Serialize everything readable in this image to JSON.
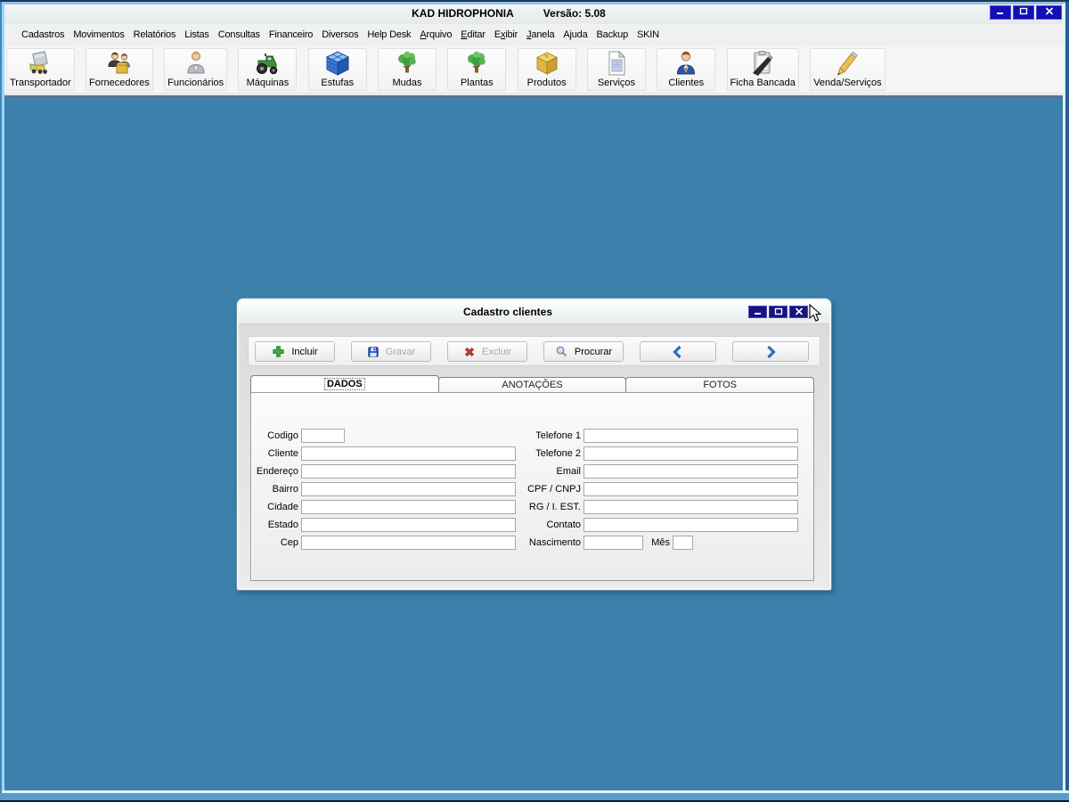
{
  "window": {
    "title": "KAD HIDROPHONIA",
    "version": "Versão: 5.08",
    "controls": [
      {
        "name": "minimize",
        "icon": "minimize-icon"
      },
      {
        "name": "maximize",
        "icon": "maximize-icon"
      },
      {
        "name": "close",
        "icon": "close-icon"
      }
    ]
  },
  "menu": {
    "items": [
      {
        "label": "Cadastros",
        "underline": -1
      },
      {
        "label": "Movimentos",
        "underline": -1
      },
      {
        "label": "Relatórios",
        "underline": -1
      },
      {
        "label": "Listas",
        "underline": -1
      },
      {
        "label": "Consultas",
        "underline": -1
      },
      {
        "label": "Financeiro",
        "underline": -1
      },
      {
        "label": "Diversos",
        "underline": -1
      },
      {
        "label": "Help Desk",
        "underline": -1
      },
      {
        "label": "Arquivo",
        "underline": 0
      },
      {
        "label": "Editar",
        "underline": 0
      },
      {
        "label": "Exibir",
        "underline": 1
      },
      {
        "label": "Janela",
        "underline": 0
      },
      {
        "label": "Ajuda",
        "underline": -1
      },
      {
        "label": "Backup",
        "underline": -1
      },
      {
        "label": "SKIN",
        "underline": -1
      }
    ]
  },
  "toolbar": {
    "buttons": [
      {
        "label": "Transportador",
        "icon": "truck-icon"
      },
      {
        "label": "Fornecedores",
        "icon": "suppliers-icon"
      },
      {
        "label": "Funcionários",
        "icon": "employee-icon"
      },
      {
        "label": "Máquinas",
        "icon": "tractor-icon"
      },
      {
        "label": "Estufas",
        "icon": "greenhouse-cube-icon"
      },
      {
        "label": "Mudas",
        "icon": "seedling-tree-icon"
      },
      {
        "label": "Plantas",
        "icon": "plant-tree-icon"
      },
      {
        "label": "Produtos",
        "icon": "product-box-icon"
      },
      {
        "label": "Serviços",
        "icon": "service-document-icon"
      },
      {
        "label": "Clientes",
        "icon": "client-person-icon"
      },
      {
        "label": "Ficha Bancada",
        "icon": "clipboard-pen-icon"
      },
      {
        "label": "Venda/Serviços",
        "icon": "pencil-icon"
      }
    ]
  },
  "dialog": {
    "title": "Cadastro clientes",
    "controls": [
      {
        "name": "minimize",
        "icon": "minimize-icon"
      },
      {
        "name": "maximize",
        "icon": "maximize-icon"
      },
      {
        "name": "close",
        "icon": "close-icon"
      }
    ],
    "actions": [
      {
        "name": "incluir",
        "label": "Incluir",
        "icon": "add-plus-icon",
        "enabled": true
      },
      {
        "name": "gravar",
        "label": "Gravar",
        "icon": "save-disk-icon",
        "enabled": false
      },
      {
        "name": "excluir",
        "label": "Excluir",
        "icon": "delete-x-icon",
        "enabled": false
      },
      {
        "name": "procurar",
        "label": "Procurar",
        "icon": "search-magnifier-icon",
        "enabled": true
      },
      {
        "name": "previous-record",
        "label": "",
        "icon": "arrow-left-icon",
        "enabled": true
      },
      {
        "name": "next-record",
        "label": "",
        "icon": "arrow-right-icon",
        "enabled": true
      }
    ],
    "tabs": [
      {
        "label": "DADOS",
        "active": true
      },
      {
        "label": "ANOTAÇÕES",
        "active": false
      },
      {
        "label": "FOTOS",
        "active": false
      }
    ],
    "form": {
      "left": [
        {
          "label": "Codigo",
          "value": "",
          "size": "small"
        },
        {
          "label": "Cliente",
          "value": ""
        },
        {
          "label": "Endereço",
          "value": ""
        },
        {
          "label": "Bairro",
          "value": ""
        },
        {
          "label": "Cidade",
          "value": ""
        },
        {
          "label": "Estado",
          "value": ""
        },
        {
          "label": "Cep",
          "value": ""
        }
      ],
      "right": [
        {
          "label": "Telefone 1",
          "value": ""
        },
        {
          "label": "Telefone 2",
          "value": ""
        },
        {
          "label": "Email",
          "value": ""
        },
        {
          "label": "CPF / CNPJ",
          "value": ""
        },
        {
          "label": "RG / I. EST.",
          "value": ""
        },
        {
          "label": "Contato",
          "value": ""
        },
        {
          "label": "Nascimento",
          "value": "",
          "size": "small"
        }
      ],
      "mes_label": "Mês",
      "mes_value": ""
    }
  },
  "colors": {
    "desktop": "#3c80ab",
    "titlebar_button_blue": "#1c19b4",
    "dialog_button_blue": "#17137f"
  }
}
